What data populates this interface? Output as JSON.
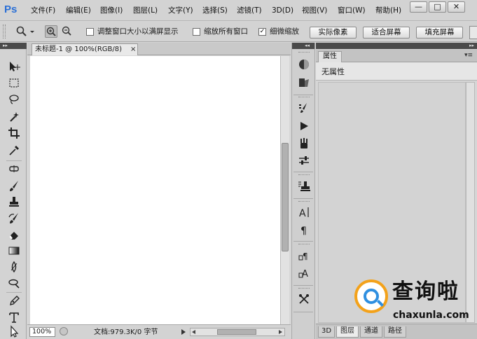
{
  "app": {
    "logo": "Ps",
    "menu": [
      "文件(F)",
      "编辑(E)",
      "图像(I)",
      "图层(L)",
      "文字(Y)",
      "选择(S)",
      "滤镜(T)",
      "3D(D)",
      "视图(V)",
      "窗口(W)",
      "帮助(H)"
    ],
    "window_buttons": {
      "minimize": "—",
      "maximize": "□",
      "close": "✕"
    }
  },
  "options": {
    "resize_windows_label": "调整窗口大小以满屏显示",
    "resize_windows_checked": false,
    "zoom_all_label": "缩放所有窗口",
    "zoom_all_checked": false,
    "scrubby_zoom_label": "细微缩放",
    "scrubby_zoom_checked": true,
    "buttons": [
      "实际像素",
      "适合屏幕",
      "填充屏幕"
    ]
  },
  "tools": [
    "move-tool",
    "marquee-tool",
    "lasso-tool",
    "quick-select-tool",
    "crop-tool",
    "eyedropper-tool",
    "spot-healing-tool",
    "brush-tool",
    "clone-stamp-tool",
    "history-brush-tool",
    "eraser-tool",
    "gradient-tool",
    "blur-tool",
    "dodge-tool",
    "pen-tool",
    "type-tool",
    "path-select-tool"
  ],
  "document": {
    "tab_title": "未标题-1 @ 100%(RGB/8)",
    "close_glyph": "×",
    "zoom_value": "100%",
    "status_text": "文档:979.3K/0 字节"
  },
  "dock": {
    "icons": [
      "color-icon",
      "swatches-icon",
      "history-icon",
      "actions-icon",
      "brush-presets-icon",
      "adjustments-icon",
      "clone-source-icon",
      "character-icon",
      "paragraph-icon",
      "paragraph-styles-icon",
      "character-styles-icon",
      "tool-presets-icon"
    ]
  },
  "properties": {
    "tab_label": "属性",
    "body_text": "无属性",
    "bottom_tabs": [
      "3D",
      "图层",
      "通道",
      "路径"
    ],
    "active_bottom_tab": "图层"
  },
  "watermark": {
    "title": "查询啦",
    "subtitle": "chaxunla.com"
  },
  "colors": {
    "accent": "#2a6fd6",
    "watermark_orange": "#f3a21b",
    "watermark_blue": "#2f8fe0"
  }
}
